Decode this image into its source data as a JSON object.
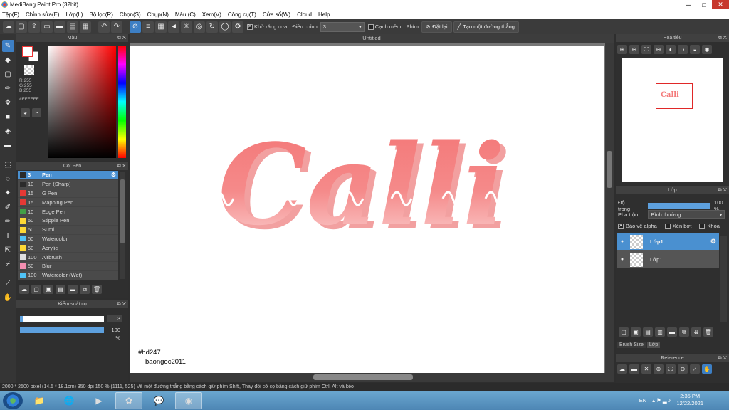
{
  "window": {
    "title": "MediBang Paint Pro (32bit)",
    "buttons": [
      "─",
      "□",
      "✕"
    ]
  },
  "menu": [
    "Tệp(F)",
    "Chỉnh sửa(E)",
    "Lớp(L)",
    "Bộ lọc(R)",
    "Chọn(S)",
    "Chụp(N)",
    "Màu (C)",
    "Xem(V)",
    "Công cụ(T)",
    "Cửa sổ(W)",
    "Cloud",
    "Help"
  ],
  "toolbar": {
    "antialias_label": "Khử răng cưa",
    "adjust_label": "Điều chỉnh",
    "adjust_value": "3",
    "snap_label": "Cạnh mềm",
    "key_label": "Phím",
    "reset_label": "Đặt lại",
    "line_label": "Tạo một đường thẳng"
  },
  "color_panel": {
    "title": "Màu",
    "rgb": "R:255\nG:255\nB:255",
    "hex": "#FFFFFF",
    "fg_color": "#e53935",
    "bg_color": "#ffffff"
  },
  "brush_panel": {
    "title": "Cọ: Pen",
    "items": [
      {
        "size": "3",
        "name": "Pen",
        "color": "#2b2b2b"
      },
      {
        "size": "10",
        "name": "Pen (Sharp)",
        "color": "#2b2b2b"
      },
      {
        "size": "15",
        "name": "G Pen",
        "color": "#e53935"
      },
      {
        "size": "15",
        "name": "Mapping Pen",
        "color": "#e53935"
      },
      {
        "size": "10",
        "name": "Edge Pen",
        "color": "#43a047"
      },
      {
        "size": "50",
        "name": "Stipple Pen",
        "color": "#fdd835"
      },
      {
        "size": "50",
        "name": "Sumi",
        "color": "#fdd835"
      },
      {
        "size": "50",
        "name": "Watercolor",
        "color": "#4fc3f7"
      },
      {
        "size": "50",
        "name": "Acrylic",
        "color": "#fdd835"
      },
      {
        "size": "100",
        "name": "Airbrush",
        "color": "#e0e0e0"
      },
      {
        "size": "50",
        "name": "Blur",
        "color": "#f48fb1"
      },
      {
        "size": "100",
        "name": "Watercolor (Wet)",
        "color": "#4fc3f7"
      }
    ]
  },
  "brush_control": {
    "title": "Kiểm soát cọ",
    "size_value": "3",
    "opacity_value": "100 %",
    "size_fraction": 0.03,
    "opacity_fraction": 1.0
  },
  "canvas": {
    "tab_title": "Untitled",
    "drawing_text": "Calli",
    "signature_line1": "#hd247",
    "signature_line2": "baongoc2011"
  },
  "navigator": {
    "title": "Hoa tiêu",
    "mini_text": "Calli"
  },
  "layer_panel": {
    "title": "Lớp",
    "opacity_label": "Độ trong",
    "opacity_value": "100 %",
    "blend_label": "Pha trộn",
    "blend_value": "Bình thường",
    "protect_alpha": "Bảo vệ alpha",
    "clipping": "Xén bớt",
    "lock": "Khóa",
    "layers": [
      {
        "name": "Lớp1",
        "active": true
      },
      {
        "name": "Lớp1",
        "active": false
      }
    ],
    "tabs": [
      "Brush Size",
      "Lớp"
    ]
  },
  "reference": {
    "title": "Reference"
  },
  "status": "2000 * 2500 pixel   (14.5 * 18.1cm)   350 dpi   150 %   (1111, 525)   Vẽ một đường thẳng bằng cách giữ phím Shift, Thay đổi cỡ cọ bằng cách giữ phím Ctrl, Alt và kéo",
  "taskbar": {
    "lang": "EN",
    "time": "2:35 PM",
    "date": "12/22/2021"
  }
}
